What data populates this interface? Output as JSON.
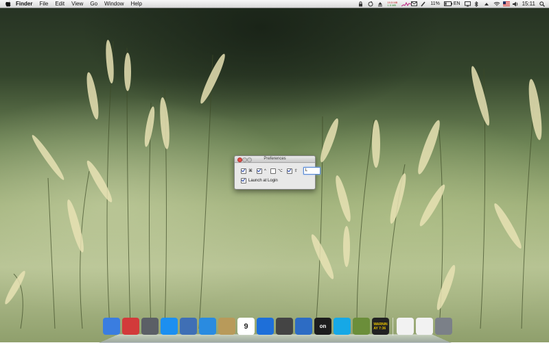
{
  "menubar": {
    "app_name": "Finder",
    "menus": [
      "File",
      "Edit",
      "View",
      "Go",
      "Window",
      "Help"
    ],
    "status": {
      "stat_line1": "19.5 MB",
      "stat_line2": "1.5 MB",
      "battery_text": "11%",
      "network_text": "EN",
      "clock": "15:11"
    }
  },
  "preferences": {
    "title": "Preferences",
    "modifiers": [
      {
        "symbol": "⌘",
        "checked": true
      },
      {
        "symbol": "^",
        "checked": true
      },
      {
        "symbol": "⌥",
        "checked": false
      },
      {
        "symbol": "⇧",
        "checked": true
      }
    ],
    "key_value": "L",
    "launch_label": "Launch at Login",
    "launch_checked": true
  },
  "dock": {
    "items": [
      {
        "name": "finder",
        "bg": "#3a7de0"
      },
      {
        "name": "floppy-save",
        "bg": "#d23a3a"
      },
      {
        "name": "launchpad",
        "bg": "#5b5f66"
      },
      {
        "name": "app-store",
        "bg": "#1c8ff0"
      },
      {
        "name": "preview",
        "bg": "#3f6fb5"
      },
      {
        "name": "safari",
        "bg": "#2a8be0"
      },
      {
        "name": "notes",
        "bg": "#b89a5a"
      },
      {
        "name": "calendar",
        "bg": "#ffffff",
        "text": "9"
      },
      {
        "name": "itunes",
        "bg": "#1e6fd9"
      },
      {
        "name": "photo-booth",
        "bg": "#444444"
      },
      {
        "name": "xcode",
        "bg": "#2d6cc4"
      },
      {
        "name": "terminal-on",
        "bg": "#1d1d1d",
        "text": "on"
      },
      {
        "name": "skype",
        "bg": "#16a8e6"
      },
      {
        "name": "notification-app",
        "bg": "#6b8e3a"
      },
      {
        "name": "console",
        "bg": "#222222",
        "text": "WARNIN\nAY 7:36"
      },
      {
        "name": "document-file",
        "bg": "#f2f2f2"
      },
      {
        "name": "pdf-file",
        "bg": "#f2f2f2"
      },
      {
        "name": "trash",
        "bg": "#7b8088"
      }
    ]
  },
  "colors": {
    "accent": "#1d3fa8",
    "close_button": "#e34f46"
  }
}
